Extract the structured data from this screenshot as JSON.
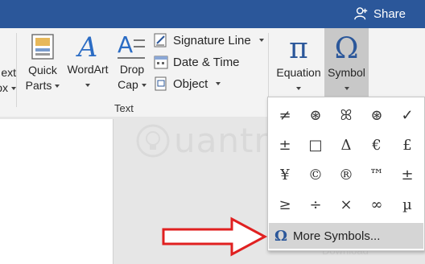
{
  "titlebar": {
    "share_label": "Share"
  },
  "ribbon": {
    "buttons": {
      "text_box": {
        "line1": "ext",
        "line2": "ox"
      },
      "quick_parts": {
        "line1": "Quick",
        "line2": "Parts"
      },
      "wordart": {
        "line1": "WordArt"
      },
      "drop_cap": {
        "line1": "Drop",
        "line2": "Cap"
      },
      "equation": {
        "line1": "Equation"
      },
      "symbol": {
        "line1": "Symbol"
      }
    },
    "small_buttons": {
      "signature_line": "Signature Line",
      "date_time": "Date & Time",
      "object": "Object"
    },
    "group_label_text": "Text",
    "icons": {
      "equation": "π",
      "symbol": "Ω",
      "wordart": "A",
      "drop_cap": "A"
    }
  },
  "symbol_dropdown": {
    "symbols": [
      "≠",
      "⊛",
      "ꕤ",
      "⊛",
      "✓",
      "±",
      "□",
      "Δ",
      "€",
      "£",
      "¥",
      "©",
      "®",
      "™",
      "±",
      "≥",
      "÷",
      "×",
      "∞",
      "µ"
    ],
    "more_symbols_label": "More Symbols...",
    "more_symbols_icon": "Ω"
  },
  "watermark": {
    "text": "uantrimang",
    "sub": "Download"
  },
  "colors": {
    "accent": "#2b579a",
    "arrow": "#e02020"
  }
}
